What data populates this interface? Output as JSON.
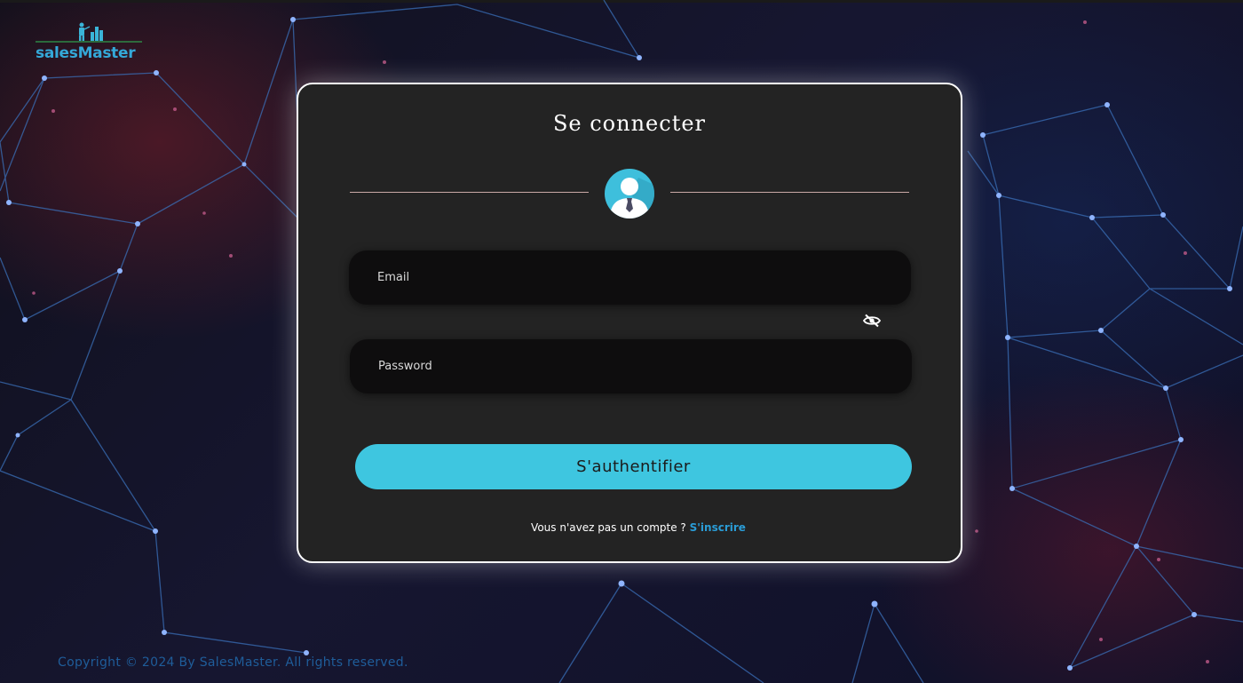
{
  "brand": {
    "name": "salesMaster",
    "accent_color": "#34a8d8"
  },
  "login": {
    "title": "Se connecter",
    "avatar_icon": "user-avatar-icon",
    "email": {
      "placeholder": "Email",
      "value": ""
    },
    "password": {
      "placeholder": "Password",
      "value": "",
      "toggle_icon": "eye-slash-icon"
    },
    "submit_label": "S'authentifier",
    "submit_color": "#3ec6e0",
    "signup_prompt": "Vous n'avez pas un compte ?",
    "signup_link": "S'inscrire",
    "signup_link_color": "#2a9cd6"
  },
  "footer": {
    "copyright": "Copyright © 2024 By SalesMaster. All rights reserved."
  }
}
